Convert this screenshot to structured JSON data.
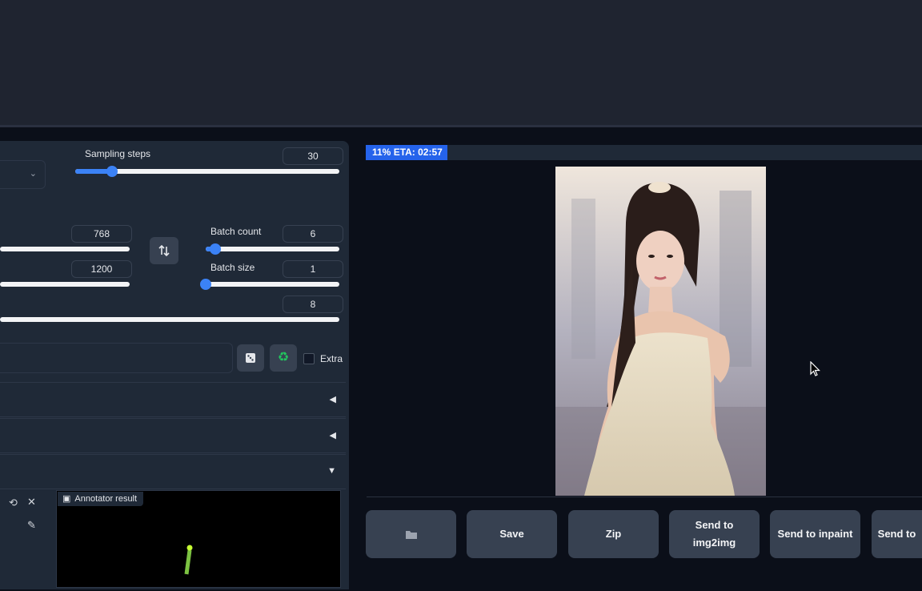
{
  "sampling": {
    "label": "Sampling steps",
    "value": "30",
    "fraction": 0.14
  },
  "dimensions": {
    "width_value": "768",
    "height_value": "1200",
    "swap_icon": "swap-vertical-arrows-icon"
  },
  "batch": {
    "count_label": "Batch count",
    "count_value": "6",
    "count_fraction": 0.07,
    "size_label": "Batch size",
    "size_value": "1",
    "size_fraction": 0.0
  },
  "cfg": {
    "value": "8"
  },
  "seed": {
    "random_icon": "dice-icon",
    "reuse_icon": "recycle-icon",
    "extra_label": "Extra"
  },
  "annotator": {
    "label": "Annotator result"
  },
  "progress": {
    "text": "11% ETA: 02:57",
    "fraction": 0.11
  },
  "actions": {
    "folder_icon": "folder-icon",
    "save": "Save",
    "zip": "Zip",
    "img2img_line1": "Send to",
    "img2img_line2": "img2img",
    "inpaint": "Send to inpaint",
    "extras": "Send to"
  },
  "colors": {
    "accent": "#3b82f6",
    "panel": "#1f2937",
    "background": "#0b0f19",
    "button": "#374151"
  }
}
